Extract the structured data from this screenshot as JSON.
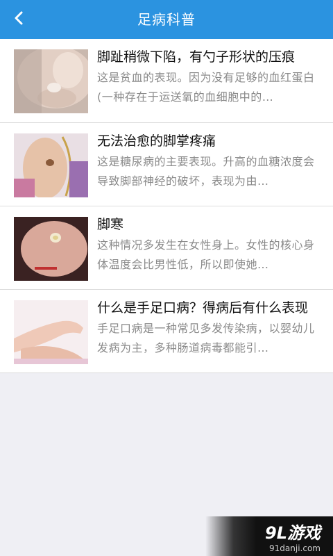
{
  "header": {
    "title": "足病科普",
    "back_icon": "chevron-left-icon",
    "color": "#2b93e0"
  },
  "articles": [
    {
      "title": "脚趾稍微下陷，有勺子形状的压痕",
      "desc": "这是贫血的表现。因为没有足够的血红蛋白(一种存在于运送氧的血细胞中的…"
    },
    {
      "title": "无法治愈的脚掌疼痛",
      "desc": "这是糖尿病的主要表现。升高的血糖浓度会导致脚部神经的破坏，表现为由…"
    },
    {
      "title": "脚寒",
      "desc": "这种情况多发生在女性身上。女性的核心身体温度会比男性低，所以即使她…"
    },
    {
      "title": "什么是手足口病？得病后有什么表现",
      "desc": "手足口病是一种常见多发传染病，以婴幼儿发病为主，多种肠道病毒都能引…"
    }
  ],
  "watermark": {
    "logo": "9L游戏",
    "url": "91danji.com"
  }
}
